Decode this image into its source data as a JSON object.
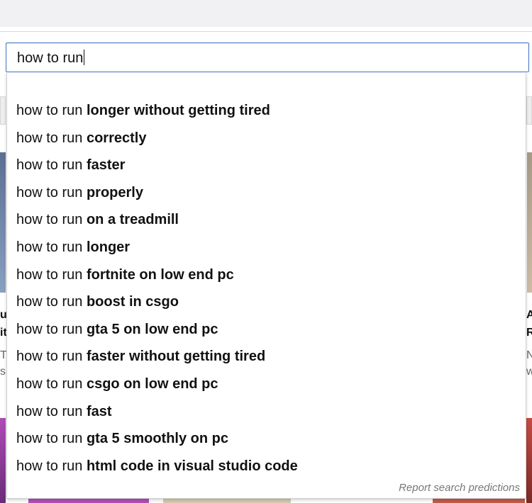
{
  "search": {
    "query": "how to run"
  },
  "suggestions": [
    {
      "prefix": "how to run",
      "completion": "longer without getting tired"
    },
    {
      "prefix": "how to run",
      "completion": "correctly"
    },
    {
      "prefix": "how to run",
      "completion": "faster"
    },
    {
      "prefix": "how to run",
      "completion": "properly"
    },
    {
      "prefix": "how to run",
      "completion": "on a treadmill"
    },
    {
      "prefix": "how to run",
      "completion": "longer"
    },
    {
      "prefix": "how to run",
      "completion": "fortnite on low end pc"
    },
    {
      "prefix": "how to run",
      "completion": "boost in csgo"
    },
    {
      "prefix": "how to run",
      "completion": "gta 5 on low end pc"
    },
    {
      "prefix": "how to run",
      "completion": "faster without getting tired"
    },
    {
      "prefix": "how to run",
      "completion": "csgo on low end pc"
    },
    {
      "prefix": "how to run",
      "completion": "fast"
    },
    {
      "prefix": "how to run",
      "completion": "gta 5 smoothly on pc"
    },
    {
      "prefix": "how to run",
      "completion": "html code in visual studio code"
    }
  ],
  "report_link": "Report search predictions",
  "background_fragments": {
    "left": [
      "u",
      "it",
      "T",
      "s"
    ],
    "right": [
      "A",
      "R",
      "N",
      "w"
    ]
  },
  "colors": {
    "focus_border": "#3e78c5",
    "toolbar": "#f1f1f3"
  }
}
